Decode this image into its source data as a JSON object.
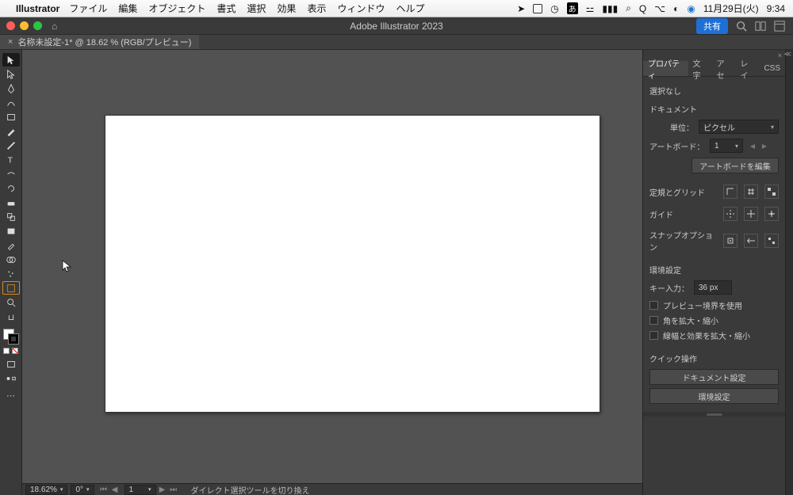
{
  "mac": {
    "app_name": "Illustrator",
    "menus": [
      "ファイル",
      "編集",
      "オブジェクト",
      "書式",
      "選択",
      "効果",
      "表示",
      "ウィンドウ",
      "ヘルプ"
    ],
    "date": "11月29日(火)",
    "time": "9:34"
  },
  "titlebar": {
    "title": "Adobe Illustrator 2023",
    "share": "共有"
  },
  "doc_tab": {
    "label": "名称未設定-1* @ 18.62 % (RGB/プレビュー)"
  },
  "panel": {
    "tabs": [
      "プロパティ",
      "文字",
      "アセ",
      "レイ",
      "CSS"
    ],
    "selection": "選択なし",
    "document": "ドキュメント",
    "unit_label": "単位：",
    "unit_value": "ピクセル",
    "artboard_label": "アートボード：",
    "artboard_value": "1",
    "edit_artboards": "アートボードを編集",
    "ruler_grid": "定規とグリッド",
    "guide": "ガイド",
    "snap": "スナップオプション",
    "prefs": "環境設定",
    "keyinput_label": "キー入力：",
    "keyinput_value": "36 px",
    "cb1": "プレビュー境界を使用",
    "cb2": "角を拡大・縮小",
    "cb3": "線幅と効果を拡大・縮小",
    "quick": "クイック操作",
    "doc_settings": "ドキュメント設定",
    "env_settings": "環境設定"
  },
  "status": {
    "zoom": "18.62%",
    "rotate": "0°",
    "artboard": "1",
    "hint": "ダイレクト選択ツールを切り換え"
  },
  "icons": {
    "grid1": "grid-corner-icon",
    "grid2": "grid-icon",
    "grid3": "grid-dashed-icon",
    "guide1": "guide-show-icon",
    "guide2": "guide-lock-icon",
    "guide3": "guide-snap-icon",
    "snap1": "snap-point-icon",
    "snap2": "snap-align-icon",
    "snap3": "snap-pixel-icon"
  }
}
